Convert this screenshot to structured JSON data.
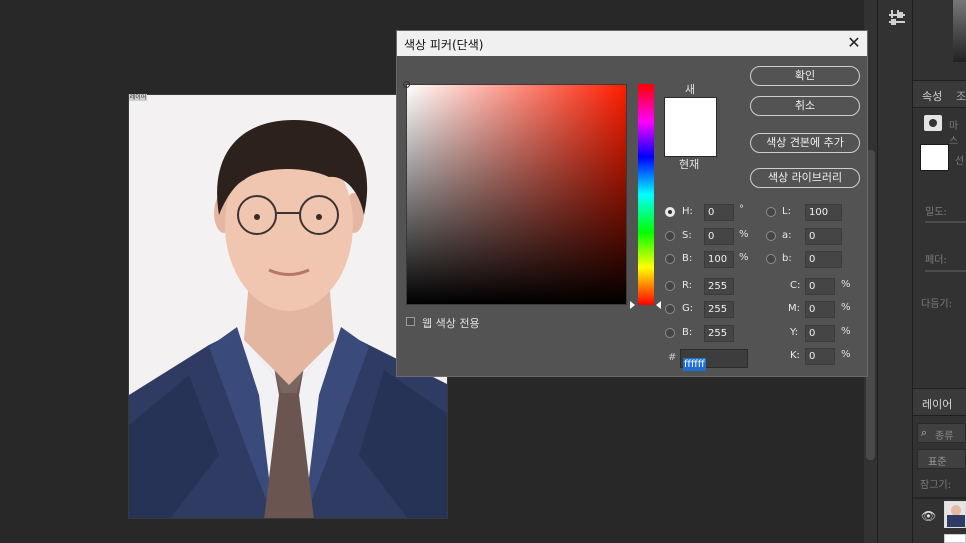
{
  "dialog": {
    "title": "색상 피커(단색)",
    "close_label": "✕",
    "new_label": "새",
    "current_label": "현재",
    "new_color": "#ffffff",
    "ok_label": "확인",
    "cancel_label": "취소",
    "add_swatch_label": "색상 견본에 추가",
    "library_label": "색상 라이브러리",
    "web_colors_label": "웹 색상 전용",
    "hue_color": "#ff1d00",
    "fields": {
      "H": {
        "label": "H:",
        "value": "0",
        "unit": "°"
      },
      "S": {
        "label": "S:",
        "value": "0",
        "unit": "%"
      },
      "Bri": {
        "label": "B:",
        "value": "100",
        "unit": "%"
      },
      "R": {
        "label": "R:",
        "value": "255"
      },
      "G": {
        "label": "G:",
        "value": "255"
      },
      "Blu": {
        "label": "B:",
        "value": "255"
      },
      "L": {
        "label": "L:",
        "value": "100"
      },
      "a": {
        "label": "a:",
        "value": "0"
      },
      "b": {
        "label": "b:",
        "value": "0"
      },
      "C": {
        "label": "C:",
        "value": "0",
        "unit": "%"
      },
      "M": {
        "label": "M:",
        "value": "0",
        "unit": "%"
      },
      "Y": {
        "label": "Y:",
        "value": "0",
        "unit": "%"
      },
      "K": {
        "label": "K:",
        "value": "0",
        "unit": "%"
      }
    },
    "hex_hash": "#",
    "hex_value": "ffffff"
  },
  "canvas": {
    "photo_tag": "레이어"
  },
  "right_panel": {
    "tab_properties": "속성",
    "tab_adjust": "조",
    "mask_label": "마스",
    "density_label": "밀도:",
    "feather_label": "페더:",
    "refine_label": "다듬기:",
    "layers_tab": "레이어",
    "search_label": "종류",
    "blend_mode": "표준",
    "lock_label": "잠그기:",
    "subject_label": "선"
  }
}
